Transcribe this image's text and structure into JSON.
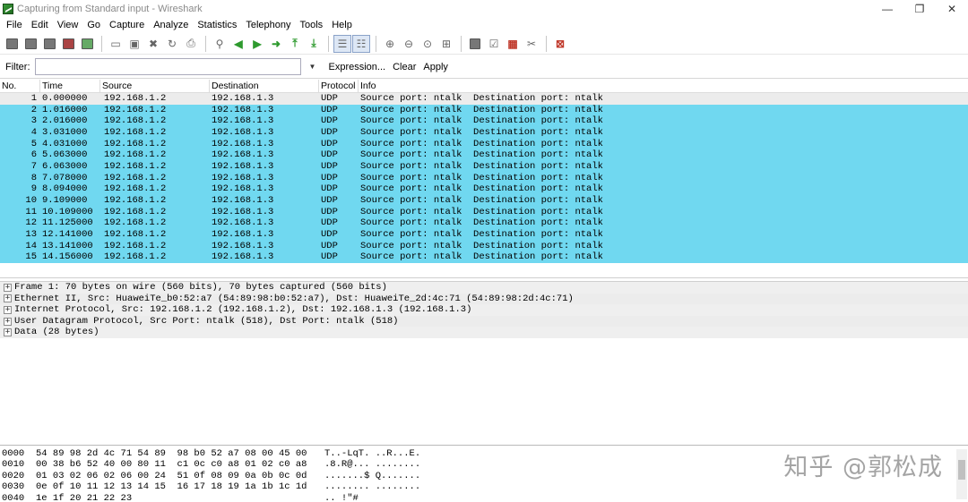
{
  "window": {
    "title": "Capturing from Standard input - Wireshark",
    "controls": [
      "—",
      "❐",
      "✕"
    ]
  },
  "menu": [
    "File",
    "Edit",
    "View",
    "Go",
    "Capture",
    "Analyze",
    "Statistics",
    "Telephony",
    "Tools",
    "Help"
  ],
  "filter": {
    "label": "Filter:",
    "value": "",
    "expression_label": "Expression...",
    "clear_label": "Clear",
    "apply_label": "Apply"
  },
  "packet_list": {
    "columns": [
      "No.",
      "Time",
      "Source",
      "Destination",
      "Protocol",
      "Info"
    ],
    "rows": [
      {
        "no": "1",
        "time": "0.000000",
        "src": "192.168.1.2",
        "dst": "192.168.1.3",
        "proto": "UDP",
        "info": "Source port: ntalk  Destination port: ntalk"
      },
      {
        "no": "2",
        "time": "1.016000",
        "src": "192.168.1.2",
        "dst": "192.168.1.3",
        "proto": "UDP",
        "info": "Source port: ntalk  Destination port: ntalk"
      },
      {
        "no": "3",
        "time": "2.016000",
        "src": "192.168.1.2",
        "dst": "192.168.1.3",
        "proto": "UDP",
        "info": "Source port: ntalk  Destination port: ntalk"
      },
      {
        "no": "4",
        "time": "3.031000",
        "src": "192.168.1.2",
        "dst": "192.168.1.3",
        "proto": "UDP",
        "info": "Source port: ntalk  Destination port: ntalk"
      },
      {
        "no": "5",
        "time": "4.031000",
        "src": "192.168.1.2",
        "dst": "192.168.1.3",
        "proto": "UDP",
        "info": "Source port: ntalk  Destination port: ntalk"
      },
      {
        "no": "6",
        "time": "5.063000",
        "src": "192.168.1.2",
        "dst": "192.168.1.3",
        "proto": "UDP",
        "info": "Source port: ntalk  Destination port: ntalk"
      },
      {
        "no": "7",
        "time": "6.063000",
        "src": "192.168.1.2",
        "dst": "192.168.1.3",
        "proto": "UDP",
        "info": "Source port: ntalk  Destination port: ntalk"
      },
      {
        "no": "8",
        "time": "7.078000",
        "src": "192.168.1.2",
        "dst": "192.168.1.3",
        "proto": "UDP",
        "info": "Source port: ntalk  Destination port: ntalk"
      },
      {
        "no": "9",
        "time": "8.094000",
        "src": "192.168.1.2",
        "dst": "192.168.1.3",
        "proto": "UDP",
        "info": "Source port: ntalk  Destination port: ntalk"
      },
      {
        "no": "10",
        "time": "9.109000",
        "src": "192.168.1.2",
        "dst": "192.168.1.3",
        "proto": "UDP",
        "info": "Source port: ntalk  Destination port: ntalk"
      },
      {
        "no": "11",
        "time": "10.109000",
        "src": "192.168.1.2",
        "dst": "192.168.1.3",
        "proto": "UDP",
        "info": "Source port: ntalk  Destination port: ntalk"
      },
      {
        "no": "12",
        "time": "11.125000",
        "src": "192.168.1.2",
        "dst": "192.168.1.3",
        "proto": "UDP",
        "info": "Source port: ntalk  Destination port: ntalk"
      },
      {
        "no": "13",
        "time": "12.141000",
        "src": "192.168.1.2",
        "dst": "192.168.1.3",
        "proto": "UDP",
        "info": "Source port: ntalk  Destination port: ntalk"
      },
      {
        "no": "14",
        "time": "13.141000",
        "src": "192.168.1.2",
        "dst": "192.168.1.3",
        "proto": "UDP",
        "info": "Source port: ntalk  Destination port: ntalk"
      },
      {
        "no": "15",
        "time": "14.156000",
        "src": "192.168.1.2",
        "dst": "192.168.1.3",
        "proto": "UDP",
        "info": "Source port: ntalk  Destination port: ntalk"
      }
    ]
  },
  "details": [
    "Frame 1: 70 bytes on wire (560 bits), 70 bytes captured (560 bits)",
    "Ethernet II, Src: HuaweiTe_b0:52:a7 (54:89:98:b0:52:a7), Dst: HuaweiTe_2d:4c:71 (54:89:98:2d:4c:71)",
    "Internet Protocol, Src: 192.168.1.2 (192.168.1.2), Dst: 192.168.1.3 (192.168.1.3)",
    "User Datagram Protocol, Src Port: ntalk (518), Dst Port: ntalk (518)",
    "Data (28 bytes)"
  ],
  "bytes": [
    {
      "offset": "0000",
      "hex": "54 89 98 2d 4c 71 54 89  98 b0 52 a7 08 00 45 00",
      "ascii": "T..-LqT. ..R...E."
    },
    {
      "offset": "0010",
      "hex": "00 38 b6 52 40 00 80 11  c1 0c c0 a8 01 02 c0 a8",
      "ascii": ".8.R@... ........"
    },
    {
      "offset": "0020",
      "hex": "01 03 02 06 02 06 00 24  51 0f 08 09 0a 0b 0c 0d",
      "ascii": ".......$ Q......."
    },
    {
      "offset": "0030",
      "hex": "0e 0f 10 11 12 13 14 15  16 17 18 19 1a 1b 1c 1d",
      "ascii": "........ ........"
    },
    {
      "offset": "0040",
      "hex": "1e 1f 20 21 22 23",
      "ascii": ".. !\"#"
    }
  ],
  "watermark": "知乎 @郭松成",
  "colors": {
    "udp_row": "#70d8f0",
    "selected_row": "#ececec"
  }
}
